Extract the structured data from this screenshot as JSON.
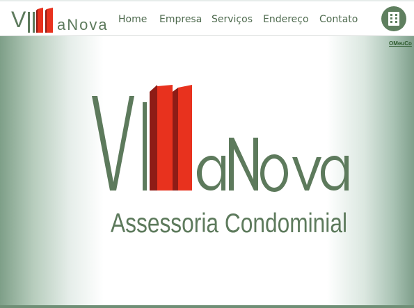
{
  "brand": {
    "logo_text": "VillaNova",
    "logo_initial": "V",
    "logo_rest": "aNova",
    "tagline": "Assessoria Condominial",
    "colors": {
      "green": "#5d7a5c",
      "red": "#e8321e",
      "dark_red": "#8e1c16"
    }
  },
  "nav": {
    "items": [
      {
        "label": "Home"
      },
      {
        "label": "Empresa"
      },
      {
        "label": "Serviços"
      },
      {
        "label": "Endereço"
      },
      {
        "label": "Contato"
      }
    ]
  },
  "header": {
    "building_icon": "building-icon"
  },
  "hero": {
    "corner_link": "OMeuCo"
  }
}
